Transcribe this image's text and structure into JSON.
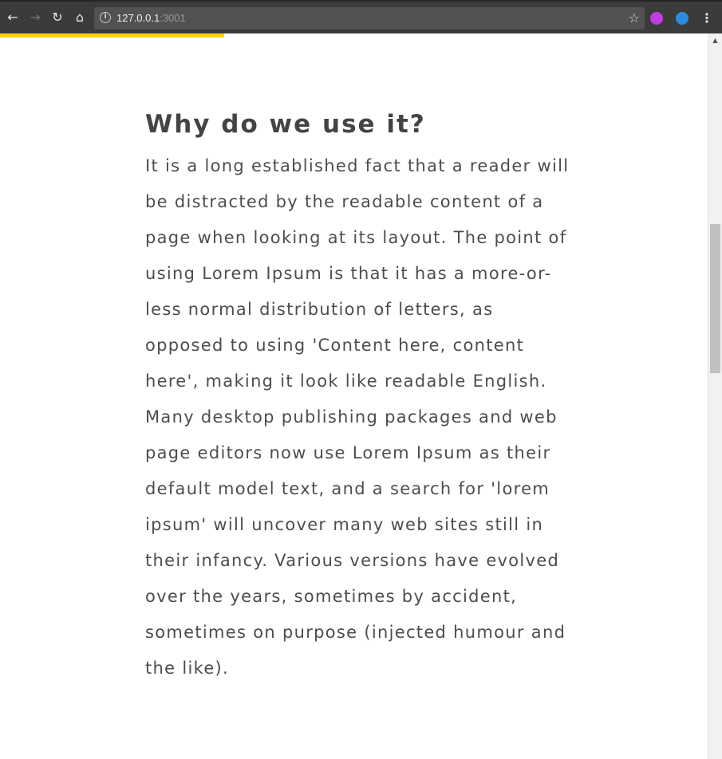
{
  "browser": {
    "url_host": "127.0.0.1",
    "url_port": ":3001",
    "back_icon": "back-arrow-icon",
    "forward_icon": "forward-arrow-icon",
    "reload_icon": "reload-icon",
    "home_icon": "home-icon",
    "info_icon": "info-icon",
    "bookmark_icon": "star-icon",
    "menu_icon": "kebab-menu-icon",
    "extensions": [
      "magenta-extension-icon",
      "blue-compass-extension-icon"
    ]
  },
  "page": {
    "loading_progress": 0.31,
    "progress_color": "#ffd400"
  },
  "article": {
    "heading": "Why do we use it?",
    "body": "It is a long established fact that a reader will be distracted by the readable content of a page when looking at its layout. The point of using Lorem Ipsum is that it has a more-or-less normal distribution of letters, as opposed to using 'Content here, content here', making it look like readable English. Many desktop publishing packages and web page editors now use Lorem Ipsum as their default model text, and a search for 'lorem ipsum' will uncover many web sites still in their infancy. Various versions have evolved over the years, sometimes by accident, sometimes on purpose (injected humour and the like)."
  }
}
